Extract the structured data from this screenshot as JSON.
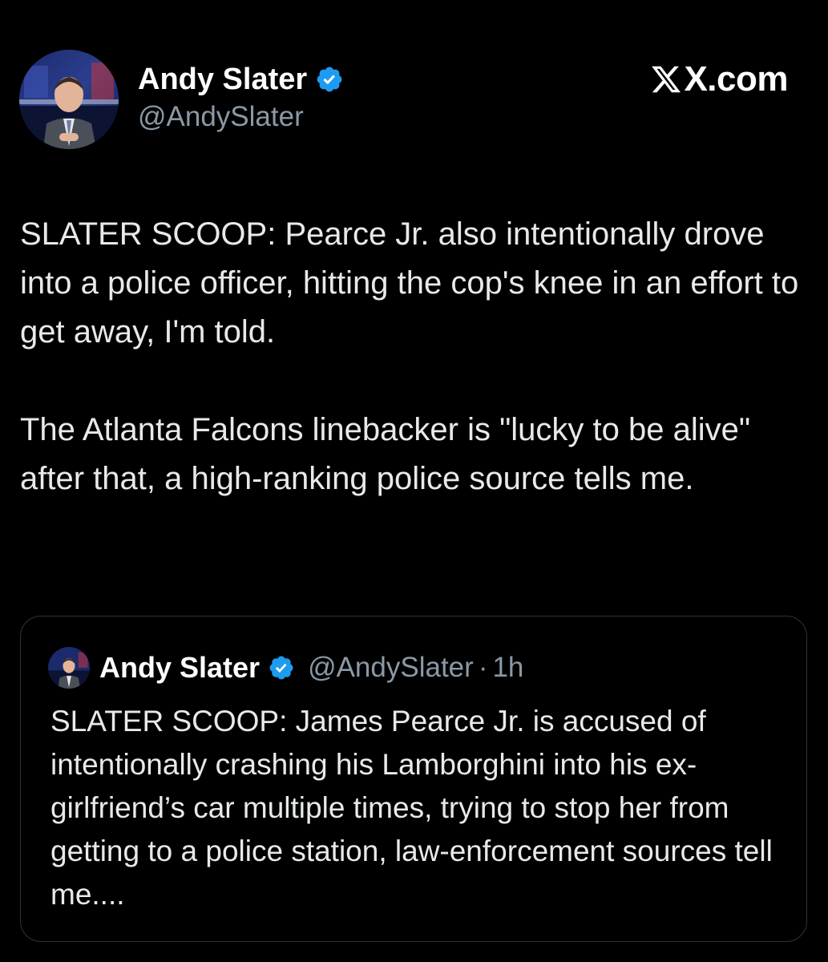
{
  "tweet": {
    "author_name": "Andy Slater",
    "author_handle": "@AndySlater",
    "brand": "X.com",
    "paragraphs": [
      "SLATER SCOOP: Pearce Jr. also intentionally drove into a police officer, hitting the cop's knee in an effort to get away, I'm told.",
      "The Atlanta Falcons linebacker is \"lucky to be alive\" after that, a high-ranking police source tells me."
    ]
  },
  "quote": {
    "author_name": "Andy Slater",
    "author_handle": "@AndySlater",
    "separator": "·",
    "time": "1h",
    "text": "SLATER SCOOP: James Pearce Jr. is accused of intentionally crashing his Lamborghini into his ex-girlfriend’s car multiple times, trying to stop her from getting to a police station, law-enforcement sources tell me...."
  },
  "icons": {
    "verified": "verified-badge-icon",
    "brand_logo": "x-logo-icon",
    "avatar": "avatar"
  },
  "colors": {
    "background": "#000000",
    "text": "#e7e9ea",
    "secondary": "#8b98a5",
    "verified": "#1d9bf0",
    "border": "#2f3336"
  }
}
